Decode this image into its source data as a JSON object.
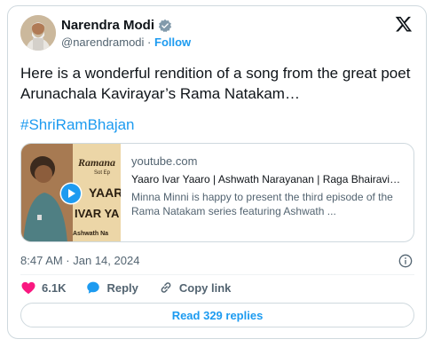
{
  "author": {
    "name": "Narendra Modi",
    "handle": "@narendramodi",
    "separator": "·",
    "follow_label": "Follow"
  },
  "tweet": {
    "text": "Here is a wonderful rendition of a song from the great poet Arunachala Kavirayar’s Rama Natakam…",
    "hashtag": "#ShriRamBhajan",
    "timestamp": "8:47 AM · Jan 14, 2024"
  },
  "link_card": {
    "thumbnail_text_1": "Ramana",
    "thumbnail_text_2": "Sot Ep",
    "thumbnail_text_3": "YAAR",
    "thumbnail_text_4": "IVAR YA",
    "thumbnail_text_5": "Ashwath Na",
    "domain": "youtube.com",
    "title": "Yaaro Ivar Yaaro | Ashwath Narayanan | Raga Bhairavi…",
    "description": "Minna Minni is happy to present the third episode of the Rama Natakam series featuring Ashwath ..."
  },
  "actions": {
    "likes": "6.1K",
    "reply_label": "Reply",
    "copy_link_label": "Copy link"
  },
  "replies_button": "Read 329 replies",
  "colors": {
    "accent": "#1d9bf0",
    "like": "#f91880",
    "text": "#0f1419",
    "muted": "#536471"
  },
  "icons": [
    "verified-badge-icon",
    "x-logo-icon",
    "play-icon",
    "info-icon",
    "heart-icon",
    "reply-icon",
    "link-icon"
  ]
}
